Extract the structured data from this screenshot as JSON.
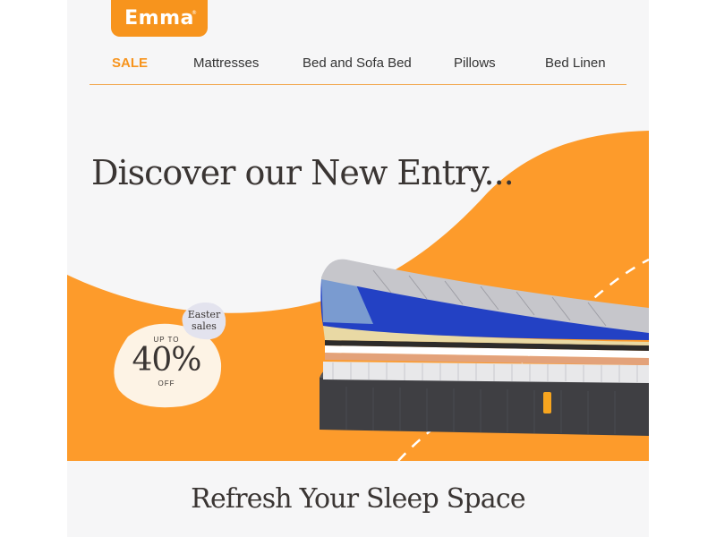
{
  "brand": {
    "logo_text": "Emma",
    "trademark": "®",
    "accent_color": "#f7941d"
  },
  "nav": {
    "items": [
      {
        "label": "SALE"
      },
      {
        "label": "Mattresses"
      },
      {
        "label": "Bed and Sofa Bed"
      },
      {
        "label": "Pillows"
      },
      {
        "label": "Bed Linen"
      }
    ]
  },
  "hero": {
    "headline": "Discover our New Entry...",
    "promo": {
      "prefix": "UP TO",
      "percent": "40%",
      "suffix": "OFF",
      "tag": "Easter sales"
    },
    "image": "mattress-layers-illustration"
  },
  "section": {
    "title": "Refresh Your Sleep Space"
  }
}
